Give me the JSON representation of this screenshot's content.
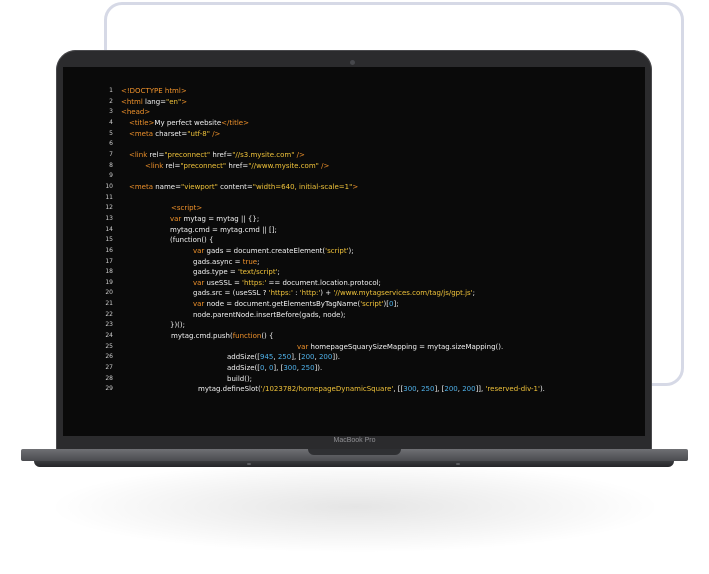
{
  "device": {
    "brand_label": "MacBook Pro"
  },
  "colors": {
    "tag": "#f0922b",
    "string": "#f0c33a",
    "number": "#4fb0e8",
    "text": "#f2f2f2",
    "screen_bg": "#0a0a0a"
  },
  "code_lines": [
    {
      "n": "1",
      "indent": 0,
      "tokens": [
        [
          "tag",
          "<!DOCTYPE html>"
        ]
      ]
    },
    {
      "n": "2",
      "indent": 0,
      "tokens": [
        [
          "tag",
          "<html "
        ],
        [
          "txt",
          "lang="
        ],
        [
          "str",
          "\"en\""
        ],
        [
          "tag",
          ">"
        ]
      ]
    },
    {
      "n": "3",
      "indent": 0,
      "tokens": [
        [
          "tag",
          "<head>"
        ]
      ]
    },
    {
      "n": "4",
      "indent": 8,
      "tokens": [
        [
          "tag",
          "<title>"
        ],
        [
          "txt",
          "My perfect website"
        ],
        [
          "tag",
          "</title>"
        ]
      ]
    },
    {
      "n": "5",
      "indent": 8,
      "tokens": [
        [
          "tag",
          "<meta "
        ],
        [
          "txt",
          "charset="
        ],
        [
          "str",
          "\"utf-8\""
        ],
        [
          "tag",
          " />"
        ]
      ]
    },
    {
      "n": "6",
      "indent": 0,
      "tokens": []
    },
    {
      "n": "7",
      "indent": 8,
      "tokens": [
        [
          "tag",
          "<link "
        ],
        [
          "txt",
          "rel="
        ],
        [
          "str",
          "\"preconnect\""
        ],
        [
          "txt",
          " href="
        ],
        [
          "str",
          "\"//s3.mysite.com\""
        ],
        [
          "tag",
          " />"
        ]
      ]
    },
    {
      "n": "8",
      "indent": 24,
      "tokens": [
        [
          "tag",
          "<link "
        ],
        [
          "txt",
          "rel="
        ],
        [
          "str",
          "\"preconnect\""
        ],
        [
          "txt",
          " href="
        ],
        [
          "str",
          "\"//www.mysite.com\""
        ],
        [
          "tag",
          " />"
        ]
      ]
    },
    {
      "n": "9",
      "indent": 0,
      "tokens": []
    },
    {
      "n": "10",
      "indent": 8,
      "tokens": [
        [
          "tag",
          "<meta "
        ],
        [
          "txt",
          "name="
        ],
        [
          "str",
          "\"viewport\""
        ],
        [
          "txt",
          " content="
        ],
        [
          "str",
          "\"width=640, initial-scale=1\""
        ],
        [
          "tag",
          ">"
        ]
      ]
    },
    {
      "n": "11",
      "indent": 0,
      "tokens": []
    },
    {
      "n": "12",
      "indent": 50,
      "tokens": [
        [
          "tag",
          "<script>"
        ]
      ]
    },
    {
      "n": "13",
      "indent": 49,
      "tokens": [
        [
          "kw",
          "var "
        ],
        [
          "txt",
          "mytag = mytag || {};"
        ]
      ]
    },
    {
      "n": "14",
      "indent": 49,
      "tokens": [
        [
          "txt",
          "mytag.cmd = mytag.cmd || [];"
        ]
      ]
    },
    {
      "n": "15",
      "indent": 49,
      "tokens": [
        [
          "txt",
          "(function() {"
        ]
      ]
    },
    {
      "n": "16",
      "indent": 72,
      "tokens": [
        [
          "kw",
          "var "
        ],
        [
          "txt",
          "gads = document.createElement("
        ],
        [
          "str",
          "'script'"
        ],
        [
          "txt",
          ");"
        ]
      ]
    },
    {
      "n": "17",
      "indent": 72,
      "tokens": [
        [
          "txt",
          "gads.async = "
        ],
        [
          "kw",
          "true"
        ],
        [
          "txt",
          ";"
        ]
      ]
    },
    {
      "n": "18",
      "indent": 72,
      "tokens": [
        [
          "txt",
          "gads.type = "
        ],
        [
          "str",
          "'text/script'"
        ],
        [
          "txt",
          ";"
        ]
      ]
    },
    {
      "n": "19",
      "indent": 72,
      "tokens": [
        [
          "kw",
          "var "
        ],
        [
          "txt",
          "useSSL = "
        ],
        [
          "str",
          "'https:'"
        ],
        [
          "txt",
          " == document.location.protocol;"
        ]
      ]
    },
    {
      "n": "20",
      "indent": 72,
      "tokens": [
        [
          "txt",
          "gads.src = (useSSL ? "
        ],
        [
          "str",
          "'https:'"
        ],
        [
          "txt",
          " : "
        ],
        [
          "str",
          "'http:'"
        ],
        [
          "txt",
          ") + "
        ],
        [
          "str",
          "'//www.mytagservices.com/tag/js/gpt.js'"
        ],
        [
          "txt",
          ";"
        ]
      ]
    },
    {
      "n": "21",
      "indent": 72,
      "tokens": [
        [
          "kw",
          "var "
        ],
        [
          "txt",
          "node = document.getElementsByTagName("
        ],
        [
          "str",
          "'script'"
        ],
        [
          "txt",
          ")["
        ],
        [
          "num",
          "0"
        ],
        [
          "txt",
          "];"
        ]
      ]
    },
    {
      "n": "22",
      "indent": 72,
      "tokens": [
        [
          "txt",
          "node.parentNode.insertBefore(gads, node);"
        ]
      ]
    },
    {
      "n": "23",
      "indent": 49,
      "tokens": [
        [
          "txt",
          "})();"
        ]
      ]
    },
    {
      "n": "24",
      "indent": 50,
      "tokens": [
        [
          "txt",
          "mytag.cmd.push("
        ],
        [
          "kw",
          "function"
        ],
        [
          "txt",
          "() {"
        ]
      ]
    },
    {
      "n": "25",
      "indent": 176,
      "tokens": [
        [
          "kw",
          "var "
        ],
        [
          "txt",
          "homepageSquarySizeMapping = mytag.sizeMapping()."
        ]
      ]
    },
    {
      "n": "26",
      "indent": 106,
      "tokens": [
        [
          "txt",
          "addSize(["
        ],
        [
          "num",
          "945"
        ],
        [
          "txt",
          ", "
        ],
        [
          "num",
          "250"
        ],
        [
          "txt",
          "], ["
        ],
        [
          "num",
          "200"
        ],
        [
          "txt",
          ", "
        ],
        [
          "num",
          "200"
        ],
        [
          "txt",
          "])."
        ]
      ]
    },
    {
      "n": "27",
      "indent": 106,
      "tokens": [
        [
          "txt",
          "addSize(["
        ],
        [
          "num",
          "0"
        ],
        [
          "txt",
          ", "
        ],
        [
          "num",
          "0"
        ],
        [
          "txt",
          "], ["
        ],
        [
          "num",
          "300"
        ],
        [
          "txt",
          ", "
        ],
        [
          "num",
          "250"
        ],
        [
          "txt",
          "])."
        ]
      ]
    },
    {
      "n": "28",
      "indent": 106,
      "tokens": [
        [
          "txt",
          "build();"
        ]
      ]
    },
    {
      "n": "29",
      "indent": 77,
      "tokens": [
        [
          "txt",
          "mytag.defineSlot("
        ],
        [
          "str",
          "'/1023782/homepageDynamicSquare'"
        ],
        [
          "txt",
          ", [["
        ],
        [
          "num",
          "300"
        ],
        [
          "txt",
          ", "
        ],
        [
          "num",
          "250"
        ],
        [
          "txt",
          "], ["
        ],
        [
          "num",
          "200"
        ],
        [
          "txt",
          ", "
        ],
        [
          "num",
          "200"
        ],
        [
          "txt",
          "]], "
        ],
        [
          "str",
          "'reserved-div-1'"
        ],
        [
          "txt",
          ")."
        ]
      ]
    }
  ]
}
